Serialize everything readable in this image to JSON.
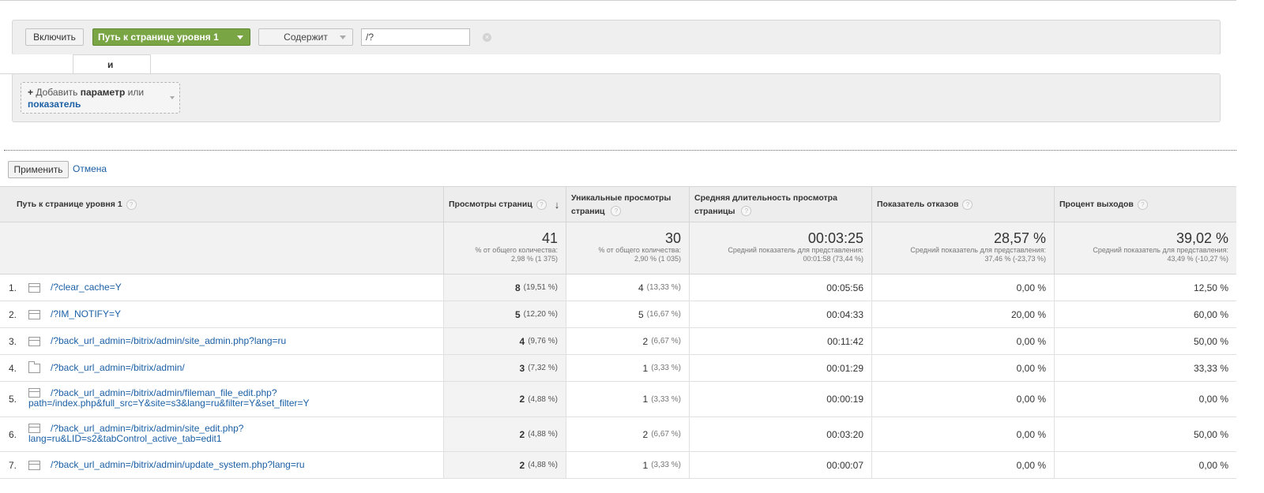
{
  "filter": {
    "include_label": "Включить",
    "dimension_label": "Путь к странице уровня 1",
    "match_label": "Содержит",
    "value": "/?"
  },
  "and_label": "и",
  "add_param": {
    "plus": "+",
    "prefix": "Добавить",
    "param_word": "параметр",
    "or_word": "или",
    "metric_word": "показатель"
  },
  "actions": {
    "apply_label": "Применить",
    "cancel_label": "Отмена"
  },
  "table": {
    "headers": {
      "dimension": "Путь к странице уровня 1",
      "pageviews": "Просмотры страниц",
      "unique_line1": "Уникальные просмотры",
      "unique_line2": "страниц",
      "avgtime_line1": "Средняя длительность просмотра",
      "avgtime_line2": "страницы",
      "bounce": "Показатель отказов",
      "exit": "Процент выходов"
    },
    "totals": {
      "pageviews": {
        "big": "41",
        "line1": "% от общего количества:",
        "line2": "2,98 % (1 375)"
      },
      "unique": {
        "big": "30",
        "line1": "% от общего количества:",
        "line2": "2,90 % (1 035)"
      },
      "avgtime": {
        "big": "00:03:25",
        "line1": "Средний показатель для представления:",
        "line2": "00:01:58 (73,44 %)"
      },
      "bounce": {
        "big": "28,57 %",
        "line1": "Средний показатель для представления:",
        "line2": "37,46 % (-23,73 %)"
      },
      "exit": {
        "big": "39,02 %",
        "line1": "Средний показатель для представления:",
        "line2": "43,49 % (-10,27 %)"
      }
    },
    "rows": [
      {
        "num": "1.",
        "icon": "page",
        "path1": "/?clear_cache=Y",
        "path2": "",
        "pv": "8",
        "pv_pct": "(19,51 %)",
        "uv": "4",
        "uv_pct": "(13,33 %)",
        "avg": "00:05:56",
        "bounce": "0,00 %",
        "exit": "12,50 %"
      },
      {
        "num": "2.",
        "icon": "page",
        "path1": "/?IM_NOTIFY=Y",
        "path2": "",
        "pv": "5",
        "pv_pct": "(12,20 %)",
        "uv": "5",
        "uv_pct": "(16,67 %)",
        "avg": "00:04:33",
        "bounce": "20,00 %",
        "exit": "60,00 %"
      },
      {
        "num": "3.",
        "icon": "page",
        "path1": "/?back_url_admin=/bitrix/admin/site_admin.php?lang=ru",
        "path2": "",
        "pv": "4",
        "pv_pct": "(9,76 %)",
        "uv": "2",
        "uv_pct": "(6,67 %)",
        "avg": "00:11:42",
        "bounce": "0,00 %",
        "exit": "50,00 %"
      },
      {
        "num": "4.",
        "icon": "folder",
        "path1": "/?back_url_admin=/bitrix/admin/",
        "path2": "",
        "pv": "3",
        "pv_pct": "(7,32 %)",
        "uv": "1",
        "uv_pct": "(3,33 %)",
        "avg": "00:01:29",
        "bounce": "0,00 %",
        "exit": "33,33 %"
      },
      {
        "num": "5.",
        "icon": "page",
        "path1": "/?back_url_admin=/bitrix/admin/fileman_file_edit.php?",
        "path2": "path=/index.php&full_src=Y&site=s3&lang=ru&filter=Y&set_filter=Y",
        "pv": "2",
        "pv_pct": "(4,88 %)",
        "uv": "1",
        "uv_pct": "(3,33 %)",
        "avg": "00:00:19",
        "bounce": "0,00 %",
        "exit": "0,00 %"
      },
      {
        "num": "6.",
        "icon": "page",
        "path1": "/?back_url_admin=/bitrix/admin/site_edit.php?",
        "path2": "lang=ru&LID=s2&tabControl_active_tab=edit1",
        "pv": "2",
        "pv_pct": "(4,88 %)",
        "uv": "2",
        "uv_pct": "(6,67 %)",
        "avg": "00:03:20",
        "bounce": "0,00 %",
        "exit": "50,00 %"
      },
      {
        "num": "7.",
        "icon": "page",
        "path1": "/?back_url_admin=/bitrix/admin/update_system.php?lang=ru",
        "path2": "",
        "pv": "2",
        "pv_pct": "(4,88 %)",
        "uv": "1",
        "uv_pct": "(3,33 %)",
        "avg": "00:00:07",
        "bounce": "0,00 %",
        "exit": "0,00 %"
      }
    ]
  }
}
